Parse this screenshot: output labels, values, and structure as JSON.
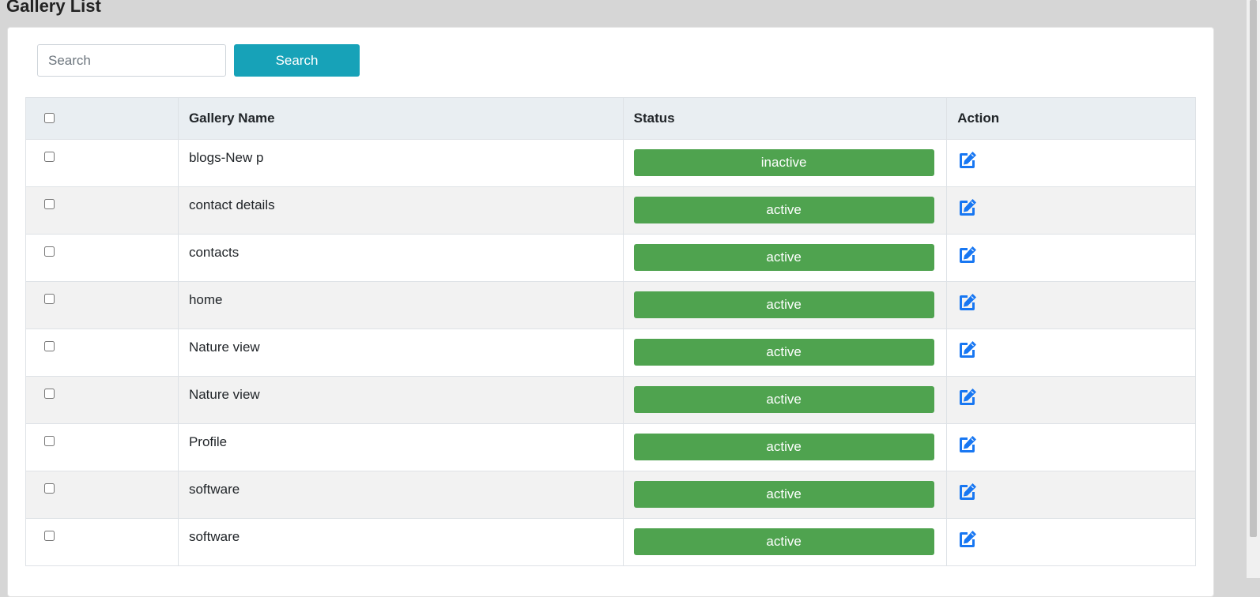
{
  "page": {
    "title": "Gallery List"
  },
  "search": {
    "placeholder": "Search",
    "value": "",
    "button_label": "Search"
  },
  "table": {
    "columns": [
      "",
      "Gallery Name",
      "Status",
      "Action"
    ],
    "rows": [
      {
        "name": "blogs-New p",
        "status": "inactive"
      },
      {
        "name": "contact details",
        "status": "active"
      },
      {
        "name": "contacts",
        "status": "active"
      },
      {
        "name": "home",
        "status": "active"
      },
      {
        "name": "Nature view",
        "status": "active"
      },
      {
        "name": "Nature view",
        "status": "active"
      },
      {
        "name": "Profile",
        "status": "active"
      },
      {
        "name": "software",
        "status": "active"
      },
      {
        "name": "software",
        "status": "active"
      }
    ]
  },
  "icons": {
    "edit": "edit-icon"
  },
  "colors": {
    "search_button": "#17a2b8",
    "status_badge": "#4fa34f",
    "edit_icon": "#1877f2",
    "header_bg": "#e9eef2"
  }
}
